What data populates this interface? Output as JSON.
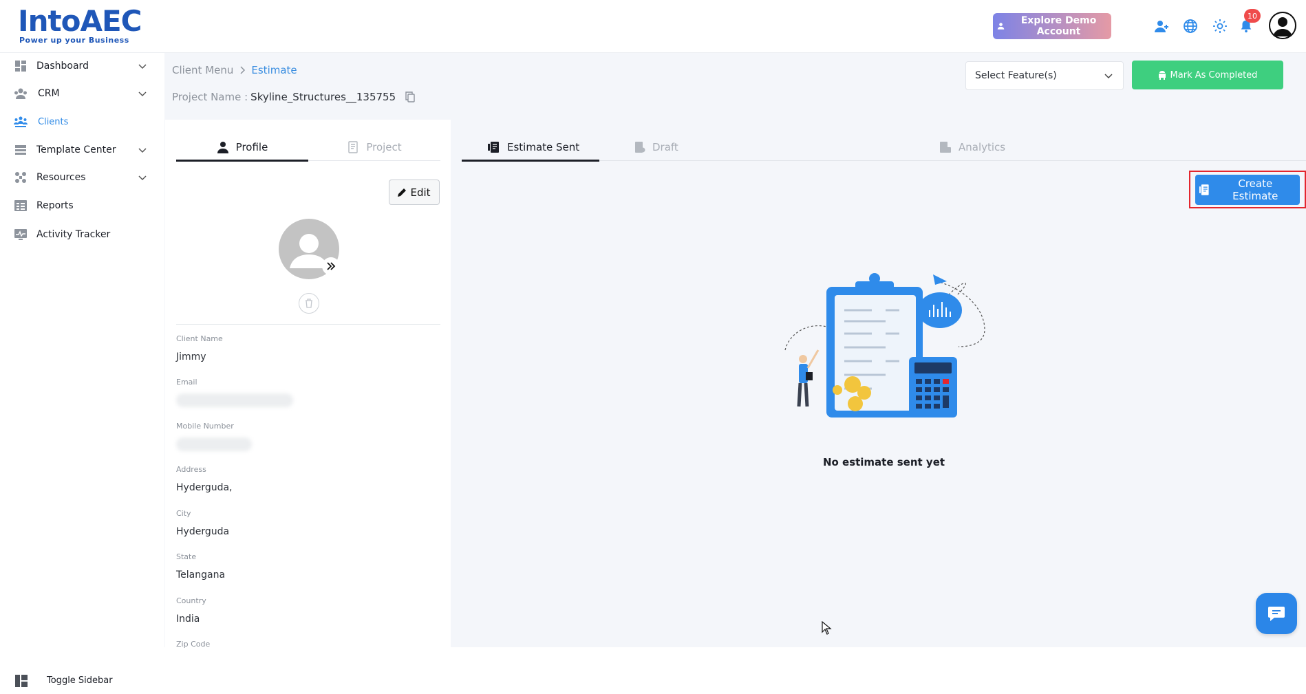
{
  "header": {
    "logo_text": "IntoAEC",
    "logo_tagline": "Power up your Business",
    "demo_button": "Explore Demo Account",
    "notification_count": "10"
  },
  "sidebar": {
    "items": [
      {
        "label": "Dashboard",
        "icon": "dashboard-icon",
        "has_chevron": true
      },
      {
        "label": "CRM",
        "icon": "crm-icon",
        "has_chevron": true
      },
      {
        "label": "Clients",
        "icon": "clients-icon",
        "has_chevron": false,
        "active": true
      },
      {
        "label": "Template Center",
        "icon": "template-icon",
        "has_chevron": true
      },
      {
        "label": "Resources",
        "icon": "resources-icon",
        "has_chevron": true
      },
      {
        "label": "Reports",
        "icon": "reports-icon",
        "has_chevron": false
      },
      {
        "label": "Activity Tracker",
        "icon": "activity-icon",
        "has_chevron": false
      }
    ],
    "toggle_label": "Toggle Sidebar"
  },
  "breadcrumb": {
    "parent": "Client Menu",
    "current": "Estimate"
  },
  "project": {
    "label": "Project Name :",
    "value": "Skyline_Structures__135755"
  },
  "toolbar": {
    "select_placeholder": "Select Feature(s)",
    "mark_completed": "Mark As Completed"
  },
  "profile_panel": {
    "tabs": [
      {
        "label": "Profile",
        "active": true
      },
      {
        "label": "Project",
        "active": false
      }
    ],
    "edit_label": "Edit",
    "fields": {
      "client_name_label": "Client Name",
      "client_name": "Jimmy",
      "email_label": "Email",
      "mobile_label": "Mobile Number",
      "address_label": "Address",
      "address": "Hyderguda,",
      "city_label": "City",
      "city": "Hyderguda",
      "state_label": "State",
      "state": "Telangana",
      "country_label": "Country",
      "country": "India",
      "zip_label": "Zip Code"
    }
  },
  "estimate_panel": {
    "tabs": [
      {
        "label": "Estimate Sent",
        "active": true
      },
      {
        "label": "Draft",
        "active": false
      },
      {
        "label": "Analytics",
        "active": false
      }
    ],
    "create_button": "Create Estimate",
    "empty_message": "No estimate sent yet"
  },
  "colors": {
    "accent": "#2f8bea",
    "success": "#3ecf7f",
    "highlight_outline": "#e3262e",
    "badge": "#ef4b4b"
  }
}
